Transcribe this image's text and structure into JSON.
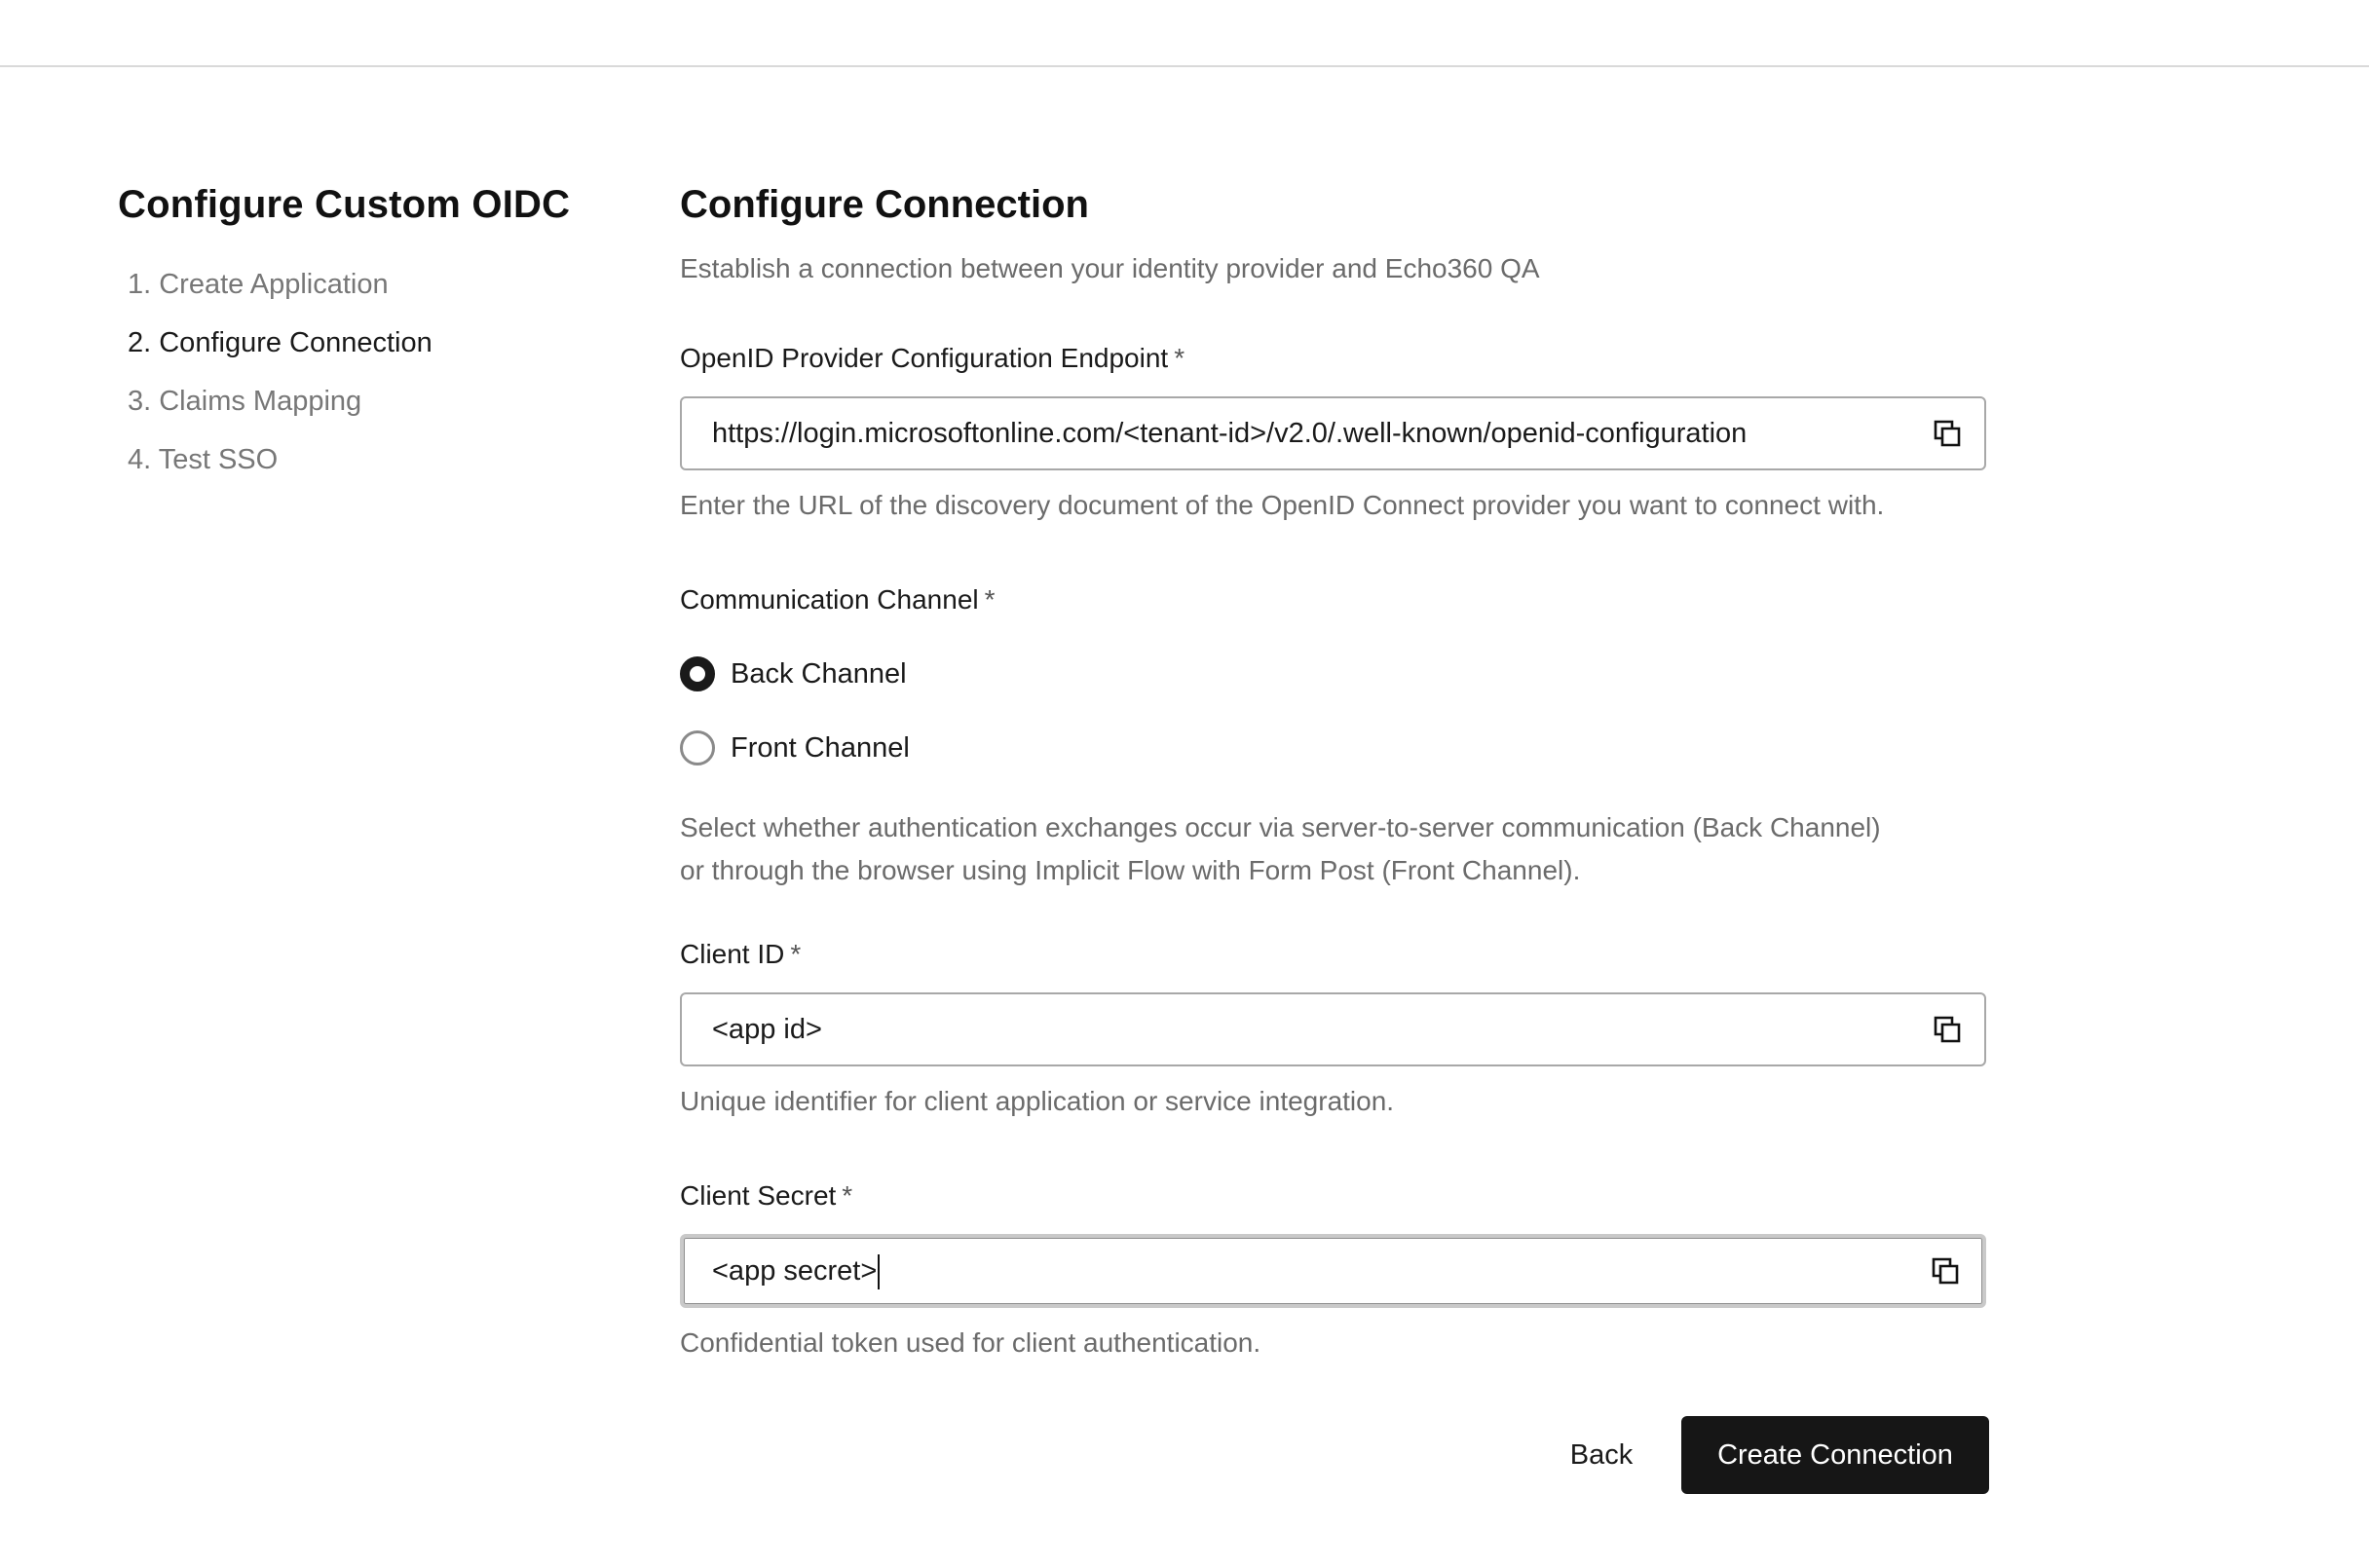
{
  "sidebar": {
    "title": "Configure Custom OIDC",
    "steps": [
      {
        "label": "1. Create Application",
        "active": false
      },
      {
        "label": "2. Configure Connection",
        "active": true
      },
      {
        "label": "3. Claims Mapping",
        "active": false
      },
      {
        "label": "4. Test SSO",
        "active": false
      }
    ]
  },
  "main": {
    "title": "Configure Connection",
    "subtitle": "Establish a connection between your identity provider and Echo360 QA",
    "endpoint": {
      "label": "OpenID Provider Configuration Endpoint",
      "required": "*",
      "value": "https://login.microsoftonline.com/<tenant-id>/v2.0/.well-known/openid-configuration",
      "help": "Enter the URL of the discovery document of the OpenID Connect provider you want to connect with.",
      "copy_icon": "copy-icon"
    },
    "channel": {
      "label": "Communication Channel",
      "required": "*",
      "options": [
        {
          "label": "Back Channel",
          "selected": true
        },
        {
          "label": "Front Channel",
          "selected": false
        }
      ],
      "help_line1": "Select whether authentication exchanges occur via server-to-server communication (Back Channel)",
      "help_line2": "or through the browser using Implicit Flow with Form Post (Front Channel)."
    },
    "client_id": {
      "label": "Client ID",
      "required": "*",
      "value": "<app id>",
      "help": "Unique identifier for client application or service integration.",
      "copy_icon": "copy-icon"
    },
    "client_secret": {
      "label": "Client Secret",
      "required": "*",
      "value": "<app secret>",
      "help": "Confidential token used for client authentication.",
      "copy_icon": "copy-icon"
    }
  },
  "actions": {
    "back_label": "Back",
    "create_label": "Create Connection"
  },
  "colors": {
    "primary_button": "#161616",
    "muted_text": "#6b6b6b",
    "border": "#a8a8a8"
  }
}
